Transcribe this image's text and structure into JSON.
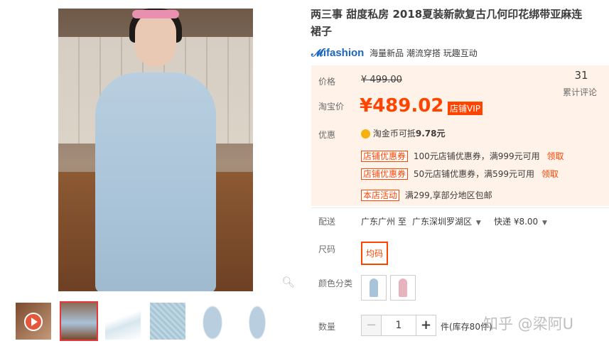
{
  "product": {
    "title": "两三事 甜度私房 2018夏装新款复古几何印花绑带亚麻连衣裙子",
    "title_line1": "两三事 甜度私房 2018夏装新款复古几何印花绑带亚麻连",
    "title_line2": "裙子"
  },
  "ifashion": {
    "logo": "ifashion",
    "tagline": "海量新品 潮流穿搭 玩趣互动"
  },
  "price": {
    "label": "价格",
    "original": "¥ 499.00",
    "taobao_label": "淘宝价",
    "current": "¥489.02",
    "vip_badge": "店铺VIP",
    "review_count": "31",
    "review_label": "累计评论"
  },
  "promo": {
    "label": "优惠",
    "coin_text": "淘金币可抵",
    "coin_value": "9.78元",
    "coupons": [
      {
        "tag": "店铺优惠券",
        "text": "100元店铺优惠券，满999元可用",
        "action": "领取"
      },
      {
        "tag": "店铺优惠券",
        "text": "50元店铺优惠券，满599元可用",
        "action": "领取"
      }
    ],
    "activity_tag": "本店活动",
    "activity_text": "满299,享部分地区包邮"
  },
  "shipping": {
    "label": "配送",
    "from": "广东广州 至",
    "to": "广东深圳罗湖区",
    "method": "快递 ¥8.00"
  },
  "size": {
    "label": "尺码",
    "option": "均码"
  },
  "color": {
    "label": "颜色分类"
  },
  "quantity": {
    "label": "数量",
    "value": "1",
    "minus": "−",
    "plus": "+",
    "stock": "件(库存80件)"
  },
  "watermark": "知乎 @梁阿U",
  "colors": {
    "accent": "#ff4400",
    "price_bg": "#fff2e8",
    "brand_blue": "#1a66c2"
  },
  "icons": [
    "zoom-icon",
    "play-icon",
    "coin-icon",
    "chevron-down-icon"
  ]
}
